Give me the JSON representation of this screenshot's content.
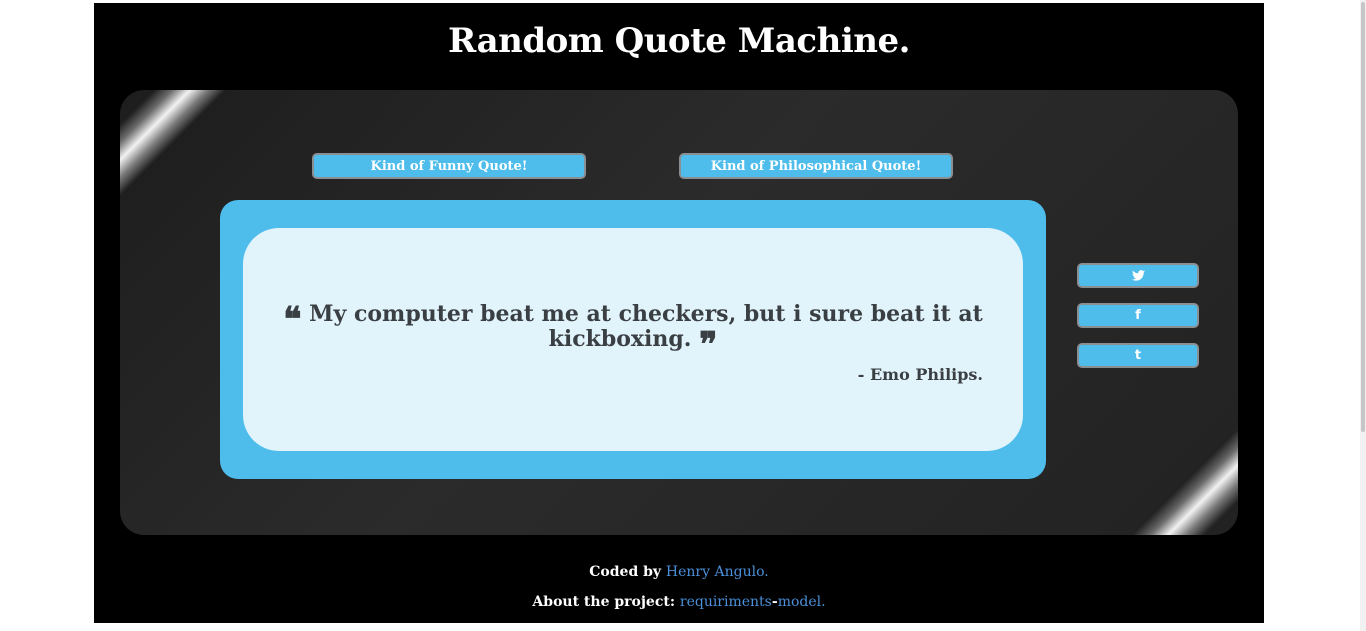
{
  "header": {
    "title": "Random Quote Machine."
  },
  "buttons": {
    "funny": "Kind of Funny Quote!",
    "philosophical": "Kind of Philosophical Quote!"
  },
  "quote": {
    "open_mark": "❝",
    "text": "My computer beat me at checkers, but i sure beat it at kickboxing.",
    "close_mark": "❞",
    "author": "- Emo Philips."
  },
  "share": {
    "twitter_icon": "twitter-icon",
    "facebook_icon": "facebook-icon",
    "tumblr_icon": "tumblr-icon",
    "twitter_glyph": "🐦",
    "facebook_glyph": "f",
    "tumblr_glyph": "t"
  },
  "footer": {
    "coded_by_label": "Coded by",
    "author_link": "Henry Angulo.",
    "about_label": "About the project:",
    "link_part1": "requiriments",
    "link_sep": "-",
    "link_part2": "model."
  },
  "colors": {
    "accent": "#4fbdec",
    "quote_bg": "#e2f4fb",
    "link": "#4a90d9",
    "page_bg": "#000000"
  }
}
